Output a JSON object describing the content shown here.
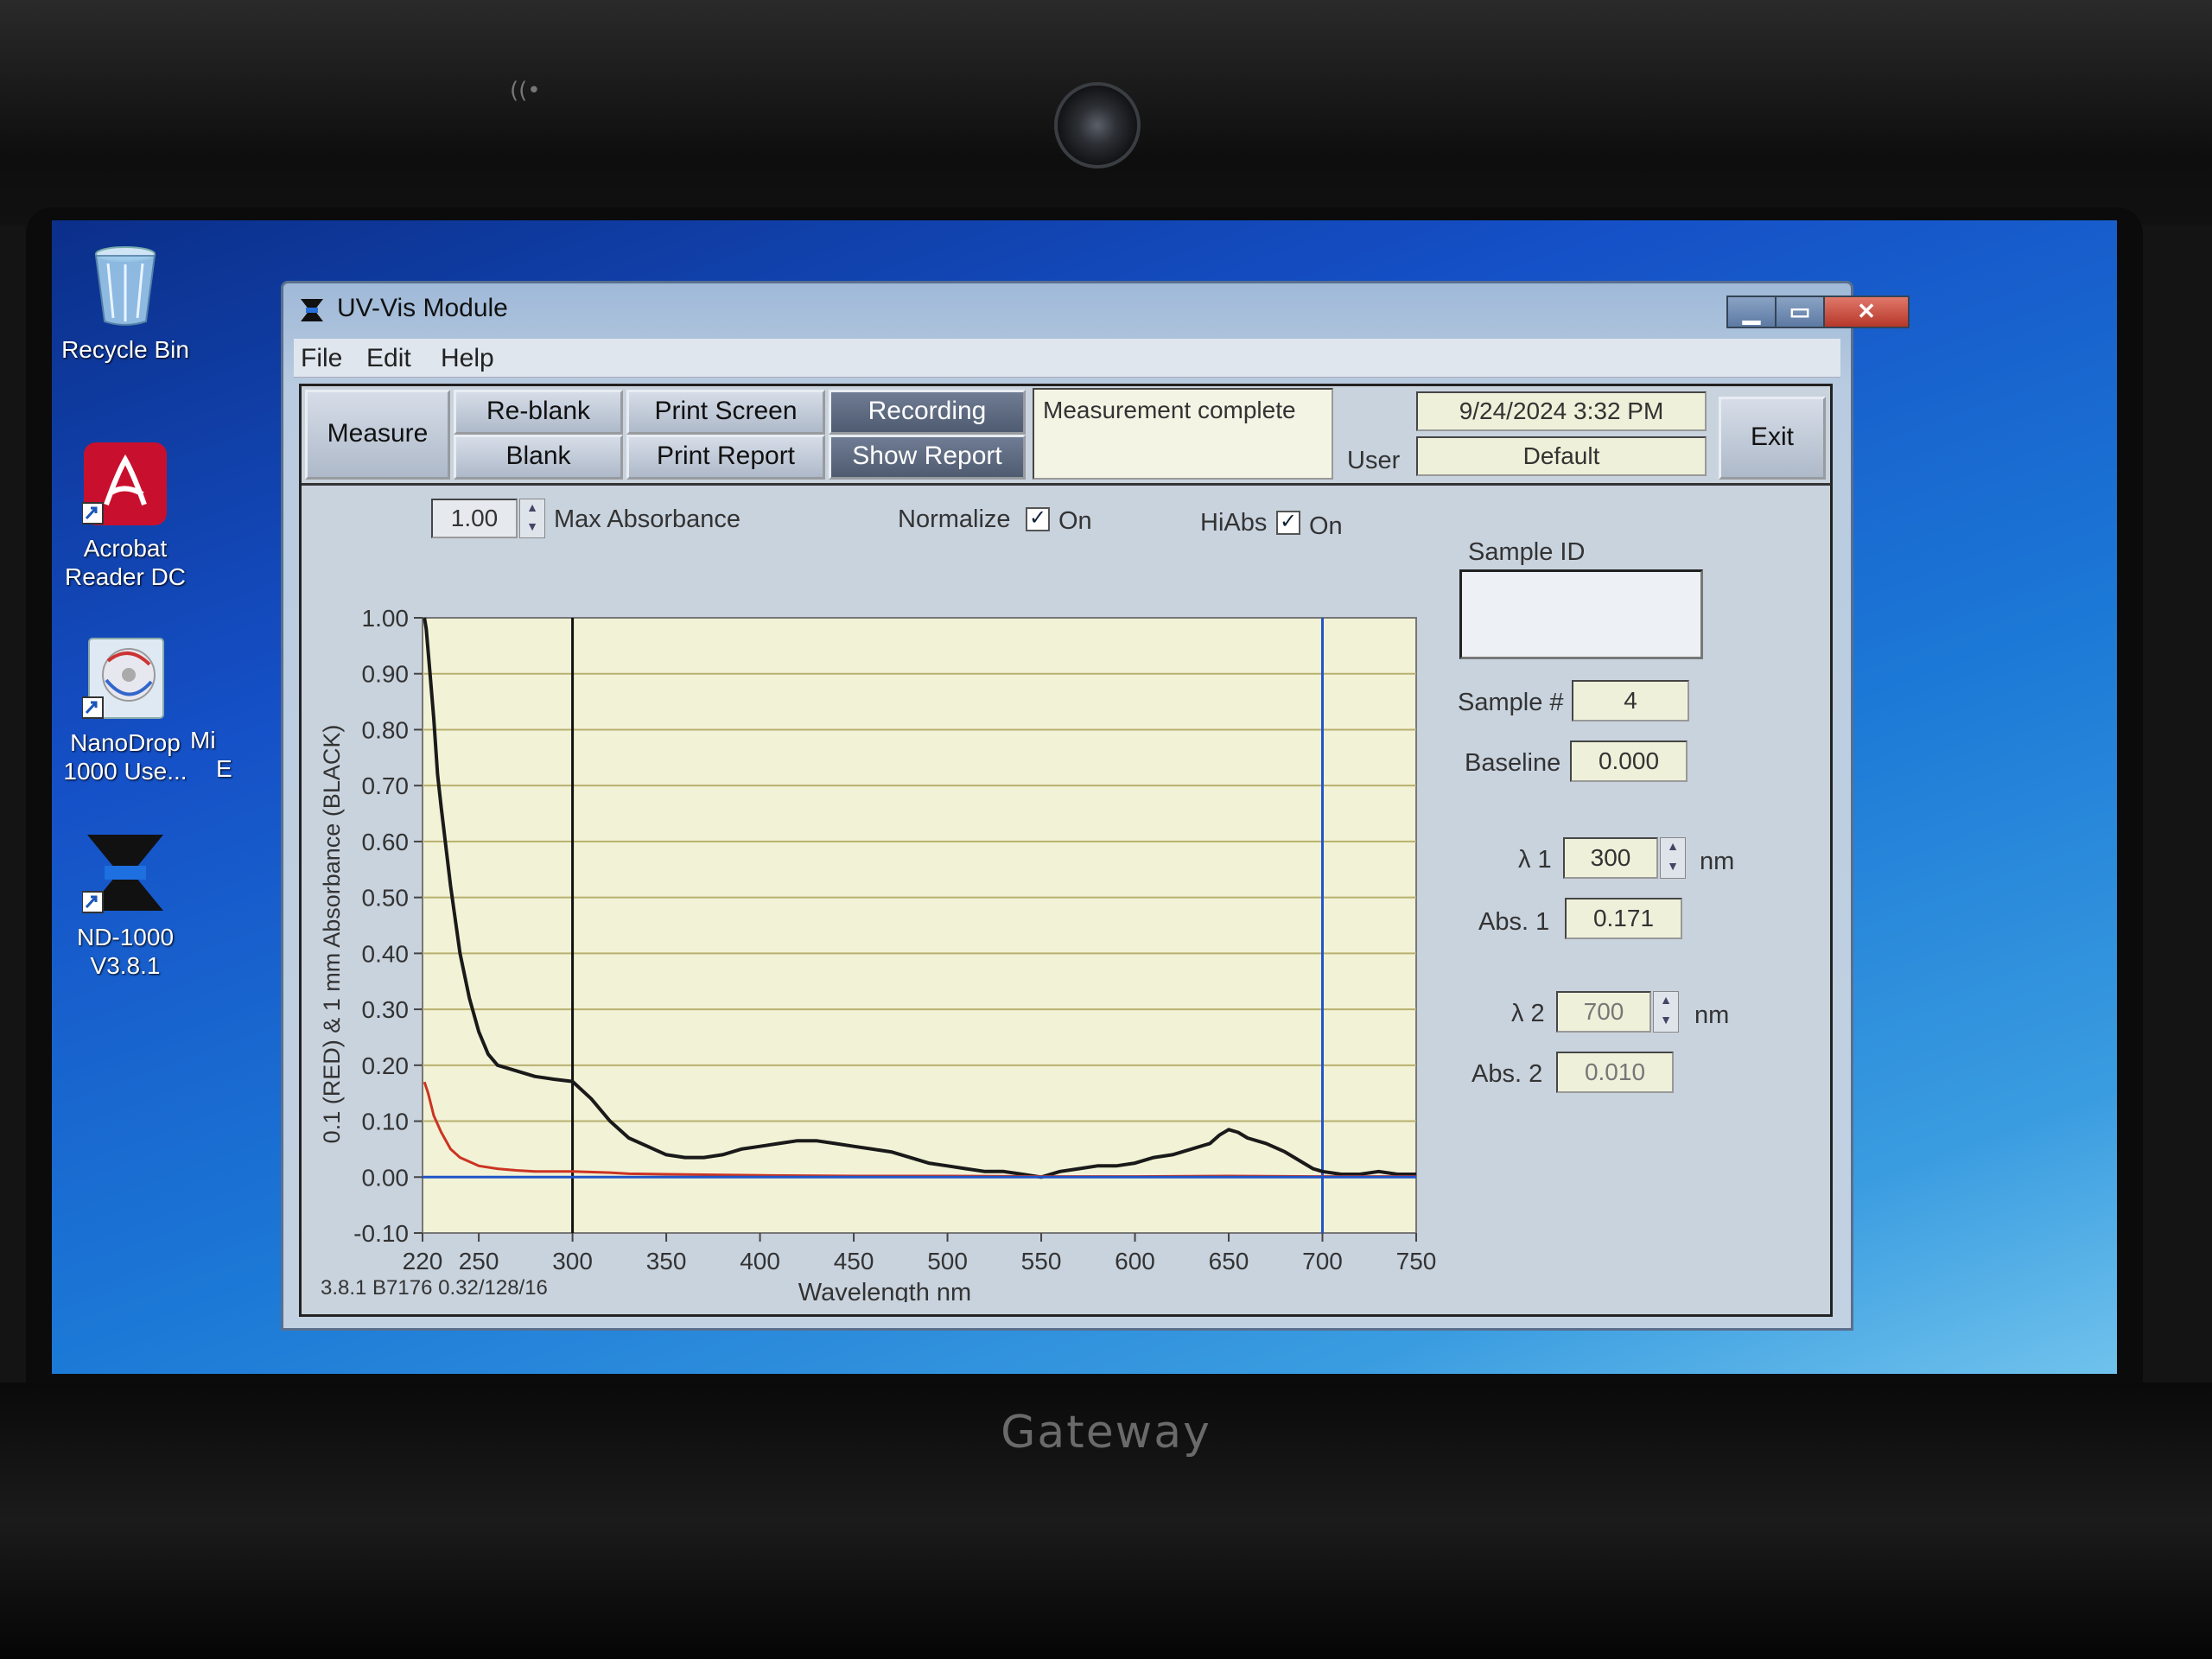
{
  "desktop": {
    "icons": [
      {
        "label_lines": [
          "Recycle Bin"
        ]
      },
      {
        "label_lines": [
          "Acrobat",
          "Reader DC"
        ]
      },
      {
        "label_lines": [
          "NanoDrop",
          "1000 Use..."
        ]
      },
      {
        "label_lines": [
          "ND-1000",
          "V3.8.1"
        ]
      }
    ],
    "partial_labels": [
      "Mi",
      "E"
    ]
  },
  "laptop": {
    "brand": "Gateway"
  },
  "window": {
    "title": "UV-Vis Module",
    "menu": [
      "File",
      "Edit",
      "Help"
    ],
    "buttons": {
      "measure": "Measure",
      "reblank": "Re-blank",
      "blank": "Blank",
      "print_screen": "Print Screen",
      "print_report": "Print Report",
      "recording": "Recording",
      "show_report": "Show Report",
      "exit": "Exit"
    },
    "status": "Measurement complete",
    "datetime": "9/24/2024  3:32 PM",
    "user_label": "User",
    "user_value": "Default",
    "max_abs_value": "1.00",
    "max_abs_label": "Max  Absorbance",
    "normalize_label": "Normalize",
    "normalize_on": "On",
    "hiabs_label": "HiAbs",
    "hiabs_on": "On",
    "sample_id_label": "Sample ID",
    "sample_id_value": "",
    "sample_num_label": "Sample #",
    "sample_num_value": "4",
    "baseline_label": "Baseline",
    "baseline_value": "0.000",
    "lambda1_label": "λ 1",
    "lambda1_value": "300",
    "lambda1_unit": "nm",
    "abs1_label": "Abs. 1",
    "abs1_value": "0.171",
    "lambda2_label": "λ 2",
    "lambda2_value": "700",
    "lambda2_unit": "nm",
    "abs2_label": "Abs. 2",
    "abs2_value": "0.010",
    "version": "3.8.1 B7176 0.32/128/16"
  },
  "chart_data": {
    "type": "line",
    "xlabel": "Wavelength nm",
    "ylabel": "0.1 (RED) & 1 mm Absorbance (BLACK)",
    "xlim": [
      220,
      750
    ],
    "ylim": [
      -0.1,
      1.0
    ],
    "x_ticks": [
      "220",
      "250",
      "300",
      "350",
      "400",
      "450",
      "500",
      "550",
      "600",
      "650",
      "700",
      "750"
    ],
    "y_ticks": [
      "1.00",
      "0.90",
      "0.80",
      "0.70",
      "0.60",
      "0.50",
      "0.40",
      "0.30",
      "0.20",
      "0.10",
      "0.00",
      "-0.10"
    ],
    "markers": [
      300,
      700
    ],
    "grid": true,
    "series": [
      {
        "color": "#1a1a1a",
        "x": [
          221,
          222,
          224,
          226,
          228,
          230,
          235,
          240,
          245,
          250,
          255,
          260,
          270,
          280,
          290,
          300,
          310,
          320,
          330,
          340,
          350,
          360,
          370,
          380,
          390,
          400,
          410,
          420,
          430,
          440,
          450,
          460,
          470,
          480,
          490,
          500,
          510,
          520,
          530,
          540,
          550,
          560,
          570,
          580,
          590,
          600,
          610,
          620,
          630,
          640,
          645,
          650,
          655,
          660,
          670,
          680,
          690,
          695,
          700,
          710,
          720,
          730,
          740,
          750
        ],
        "y": [
          1.0,
          0.98,
          0.9,
          0.82,
          0.72,
          0.66,
          0.52,
          0.4,
          0.32,
          0.26,
          0.22,
          0.2,
          0.19,
          0.18,
          0.175,
          0.171,
          0.14,
          0.1,
          0.07,
          0.055,
          0.04,
          0.035,
          0.035,
          0.04,
          0.05,
          0.055,
          0.06,
          0.065,
          0.065,
          0.06,
          0.055,
          0.05,
          0.045,
          0.035,
          0.025,
          0.02,
          0.015,
          0.01,
          0.01,
          0.005,
          0.0,
          0.01,
          0.015,
          0.02,
          0.02,
          0.025,
          0.035,
          0.04,
          0.05,
          0.06,
          0.075,
          0.085,
          0.08,
          0.07,
          0.06,
          0.045,
          0.025,
          0.015,
          0.01,
          0.005,
          0.005,
          0.01,
          0.005,
          0.005
        ]
      },
      {
        "color": "#cc3322",
        "x": [
          221,
          223,
          226,
          230,
          235,
          240,
          250,
          260,
          270,
          280,
          300,
          320,
          330,
          350,
          400,
          450,
          500,
          550,
          600,
          650,
          700,
          750
        ],
        "y": [
          0.17,
          0.15,
          0.11,
          0.08,
          0.05,
          0.035,
          0.02,
          0.015,
          0.012,
          0.01,
          0.01,
          0.008,
          0.006,
          0.005,
          0.003,
          0.002,
          0.002,
          0.001,
          0.001,
          0.002,
          0.001,
          0.001
        ]
      },
      {
        "color": "#1f55c8",
        "x": [
          220,
          750
        ],
        "y": [
          0.0,
          0.0
        ]
      }
    ]
  }
}
